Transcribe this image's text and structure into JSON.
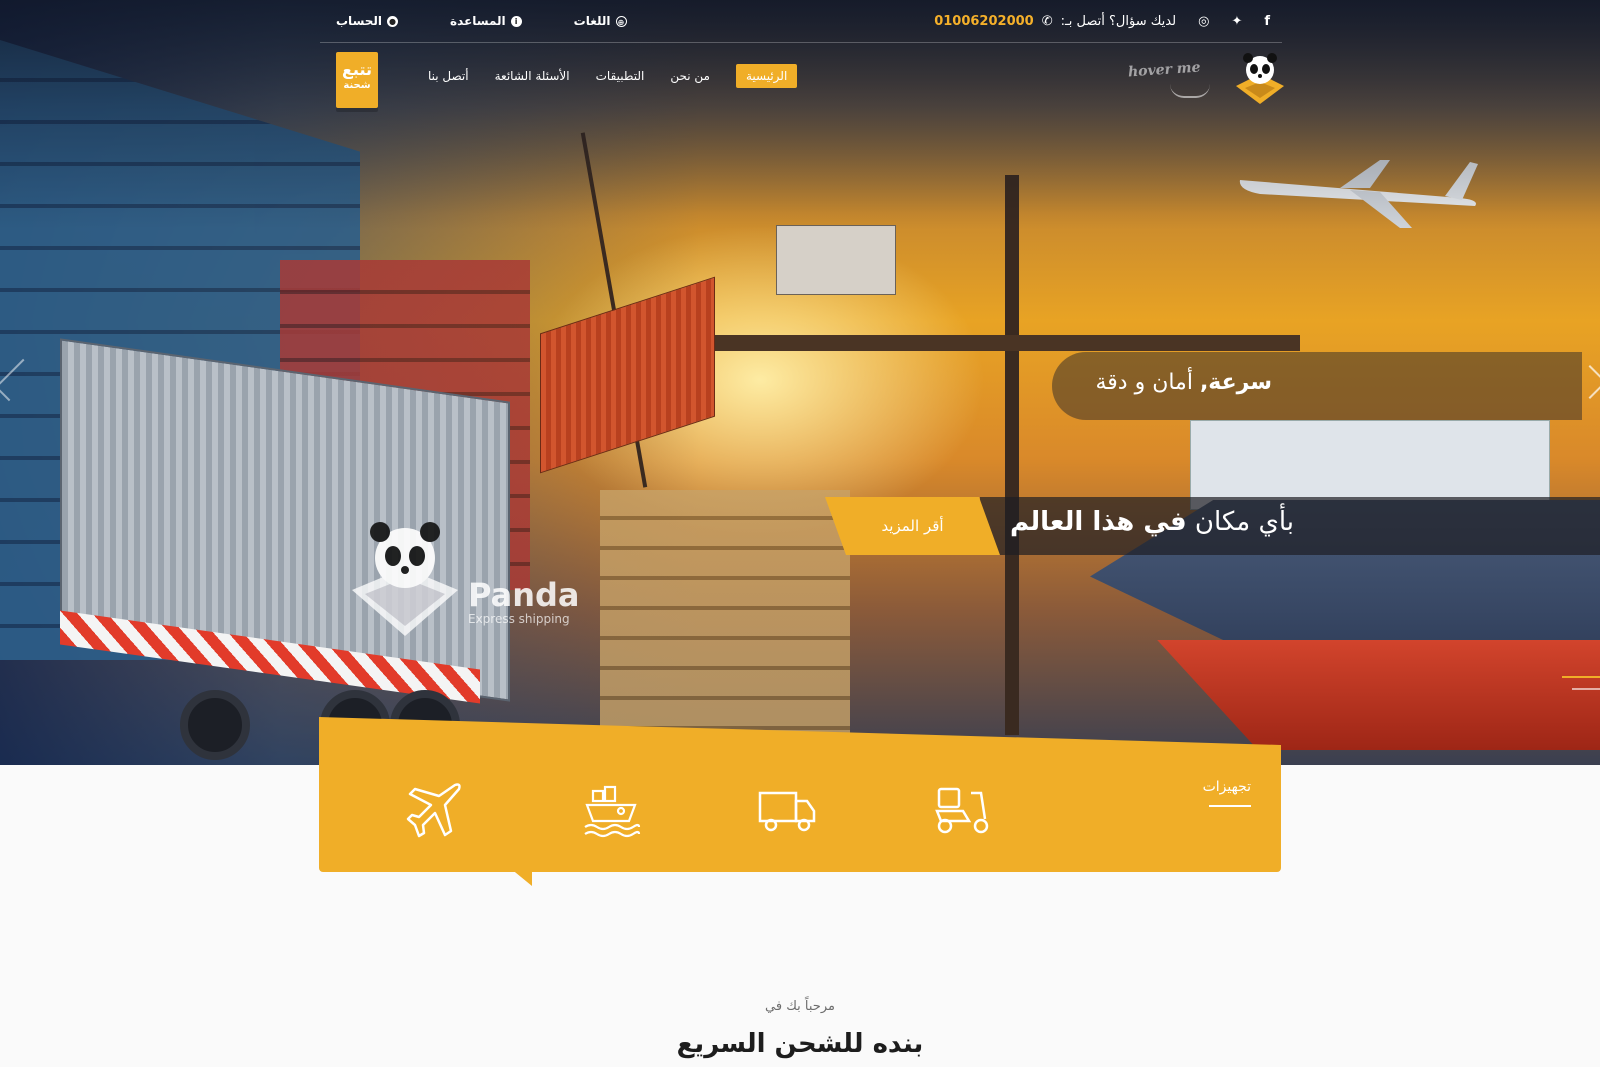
{
  "topbar": {
    "account": "الحساب",
    "help": "المساعدة",
    "languages": "اللغات",
    "phone": "01006202000",
    "question": "لديك سؤال؟ أتصل بـ:"
  },
  "nav": {
    "track_line1": "تتبع",
    "track_line2": "شحنة",
    "items": [
      "أتصل بنا",
      "الأسئلة الشائعة",
      "التطبيقات",
      "من نحن",
      "الرئيسية"
    ],
    "hover_hint": "hover me"
  },
  "hero": {
    "caption1_bold": "سرعة,",
    "caption1_rest": " أمان و دقة",
    "caption2_pre": "بأي مكان ",
    "caption2_bold": "في هذا العالم",
    "more_button": "أقر المزيد",
    "watermark_brand": "Panda",
    "watermark_sub": "Express shipping"
  },
  "services": {
    "title": "تجهيزات",
    "icons": [
      "plane-icon",
      "ship-icon",
      "truck-icon",
      "scooter-icon"
    ]
  },
  "welcome": {
    "small": "مرحباً بك في",
    "large": "بنده للشحن السريع"
  },
  "colors": {
    "accent": "#f0ae28",
    "dark": "#1d1d1d"
  }
}
